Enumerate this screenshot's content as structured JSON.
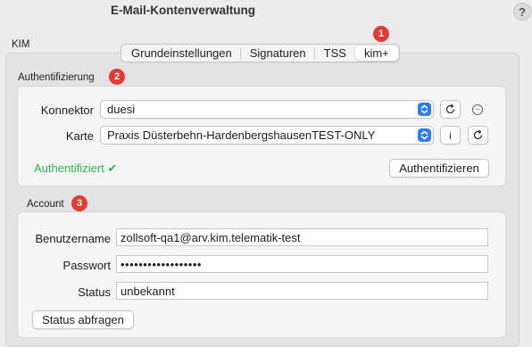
{
  "window": {
    "title": "E-Mail-Kontenverwaltung",
    "help_label": "?"
  },
  "section_label": "KIM",
  "tabs": [
    {
      "label": "Grundeinstellungen",
      "active": false
    },
    {
      "label": "Signaturen",
      "active": false
    },
    {
      "label": "TSS",
      "active": false
    },
    {
      "label": "kim+",
      "active": true
    }
  ],
  "badges": [
    "1",
    "2",
    "3"
  ],
  "auth": {
    "title": "Authentifizierung",
    "konnektor_label": "Konnektor",
    "konnektor_value": "duesi",
    "karte_label": "Karte",
    "karte_value": "Praxis Düsterbehn-HardenbergshausenTEST-ONLY",
    "info_label": "i",
    "status_text": "Authentifiziert ✔",
    "authenticate_label": "Authentifizieren"
  },
  "account": {
    "title": "Account",
    "username_label": "Benutzername",
    "username_value": "zollsoft-qa1@arv.kim.telematik-test",
    "password_label": "Passwort",
    "password_value": "••••••••••••••••••",
    "status_label": "Status",
    "status_value": "unbekannt",
    "query_label": "Status abfragen"
  },
  "colors": {
    "accent": "#2f7cf6",
    "badge": "#e23b33",
    "success": "#2fb84a"
  },
  "icons": [
    "help-icon",
    "refresh-icon",
    "more-icon",
    "info-icon",
    "chevron-updown-icon",
    "checkmark-icon"
  ]
}
